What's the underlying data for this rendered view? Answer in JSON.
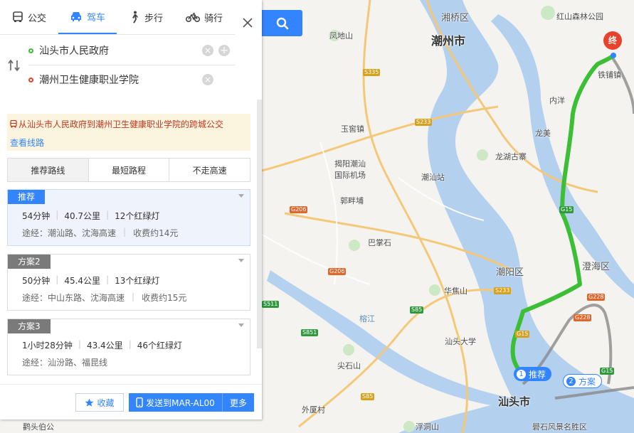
{
  "modes": [
    {
      "label": "公交",
      "icon": "bus-icon"
    },
    {
      "label": "驾车",
      "icon": "car-icon"
    },
    {
      "label": "步行",
      "icon": "walk-icon"
    },
    {
      "label": "骑行",
      "icon": "bike-icon"
    }
  ],
  "search": {
    "start": "汕头市人民政府",
    "end": "潮州卫生健康职业学院"
  },
  "notice": {
    "text": "从汕头市人民政府到潮州卫生健康职业学院的跨城公交",
    "link": "查看线路"
  },
  "tabs": [
    "推荐路线",
    "最短路程",
    "不走高速"
  ],
  "routes": [
    {
      "badge": "推荐",
      "time": "54分钟",
      "distance": "40.7公里",
      "lights": "12个红绿灯",
      "via": "途经：潮汕路、沈海高速",
      "toll": "收费约14元"
    },
    {
      "badge": "方案2",
      "time": "50分钟",
      "distance": "45.4公里",
      "lights": "13个红绿灯",
      "via": "途经：中山东路、沈海高速",
      "toll": "收费约15元"
    },
    {
      "badge": "方案3",
      "time": "1小时28分钟",
      "distance": "43.4公里",
      "lights": "46个红绿灯",
      "via": "途经：汕汾路、福昆线",
      "toll": ""
    }
  ],
  "footer": {
    "favorite": "收藏",
    "send": "发送到MAR-AL00",
    "more": "更多"
  },
  "map": {
    "labels": {
      "xiangqiao": "湘桥区",
      "chaozhou": "潮州市",
      "fengdishan": "凤地山",
      "honghill": "红山森林公园",
      "tiepu": "铁铺镇",
      "neiyang": "内洋",
      "longmei": "龙美",
      "yutang": "玉窖镇",
      "airport1": "揭阳潮汕",
      "airport2": "国际机场",
      "chaoshanstation": "潮汕站",
      "longhu": "龙湖古寨",
      "guozhuang": "郭畔埔",
      "bazhangshi": "巴掌石",
      "chenghai": "澄海区",
      "chaoan": "潮阳区",
      "huajiaoshan": "华焦山",
      "stu": "汕头大学",
      "jianshishan": "尖石山",
      "shantou": "汕头市",
      "waixia": "外厦村",
      "queshi": "礐石风景名胜区",
      "fushan": "浮洞山",
      "lingxia": "鹳头伯公",
      "lianjiang": "榕江"
    },
    "shields": [
      "S335",
      "S233",
      "G206",
      "G15",
      "S233",
      "G15",
      "S511",
      "G206",
      "S85",
      "S851",
      "S85",
      "G228",
      "G228",
      "G15"
    ],
    "tag_recommended": "推荐",
    "tag_alt": "方案",
    "tag_rec_num": "1",
    "tag_alt_num": "2",
    "end_pin": "终"
  },
  "colors": {
    "accent": "#3385ff",
    "route": "#3cbf35",
    "notice_text": "#c4341b",
    "end_pin": "#e8412c"
  }
}
